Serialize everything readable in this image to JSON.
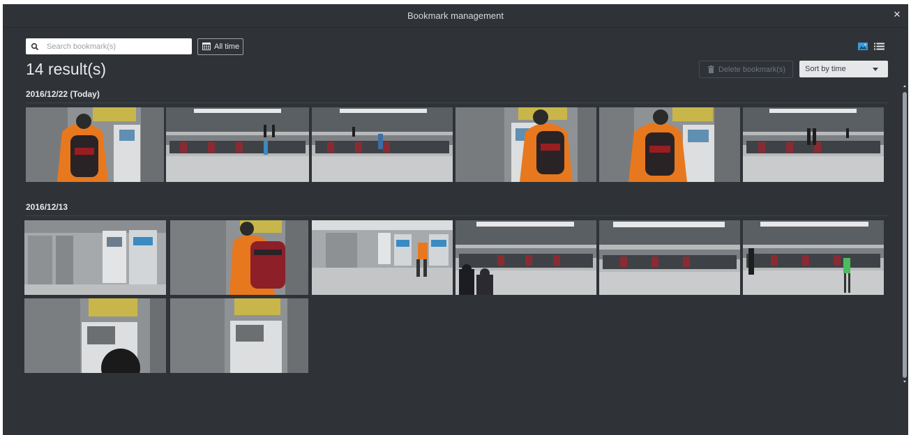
{
  "window": {
    "title": "Bookmark management"
  },
  "toolbar": {
    "search_placeholder": "Search bookmark(s)",
    "search_value": "",
    "time_filter_label": "All time",
    "delete_label": "Delete bookmark(s)",
    "sort_label": "Sort by time"
  },
  "results": {
    "summary": "14 result(s)"
  },
  "groups": [
    {
      "label": "2016/12/22 (Today)",
      "thumbnails": [
        {
          "scene": "ticket-machine-orange-jacket-backpack"
        },
        {
          "scene": "station-fare-gates-wide"
        },
        {
          "scene": "station-fare-gates-wide-person"
        },
        {
          "scene": "ticket-machine-orange-jacket-backpack"
        },
        {
          "scene": "ticket-machine-orange-jacket-backpack"
        },
        {
          "scene": "station-fare-gates-wide-people"
        }
      ]
    },
    {
      "label": "2016/12/13",
      "thumbnails": [
        {
          "scene": "ticket-machines-empty"
        },
        {
          "scene": "ticket-machine-orange-jacket-backpack"
        },
        {
          "scene": "ticket-machines-walking-person"
        },
        {
          "scene": "station-fare-gates-crowd"
        },
        {
          "scene": "station-fare-gates-wide"
        },
        {
          "scene": "station-fare-gates-green-vest"
        },
        {
          "scene": "ticket-machine-head"
        },
        {
          "scene": "ticket-machine-empty"
        }
      ]
    }
  ],
  "icons": {
    "search": "search-icon",
    "calendar": "calendar-icon",
    "grid_view": "image-view-icon",
    "list_view": "list-view-icon",
    "trash": "trash-icon",
    "close": "close-icon"
  },
  "colors": {
    "background": "#2f3338",
    "accent": "#3a9bd8",
    "text": "#e8eaed"
  }
}
